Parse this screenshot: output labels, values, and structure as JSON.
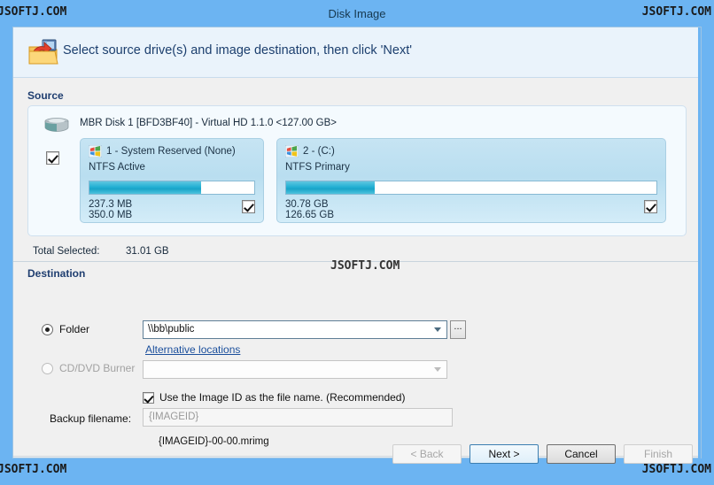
{
  "window": {
    "title": "Disk Image",
    "accent_color": "#6cb4f2"
  },
  "watermarks": {
    "top_left": "JSOFTJ.COM",
    "top_right": "JSOFTJ.COM",
    "bottom_left": "JSOFTJ.COM",
    "bottom_right": "JSOFTJ.COM",
    "center": "JSOFTJ.COM"
  },
  "header": {
    "instruction": "Select source drive(s) and image destination, then click 'Next'",
    "icon": "folder-restore-icon"
  },
  "source": {
    "heading": "Source",
    "disk": {
      "icon": "hard-disk-icon",
      "label": "MBR Disk 1 [BFD3BF40] - Virtual HD 1.1.0  <127.00 GB>",
      "selected": true
    },
    "partitions": [
      {
        "icon": "windows-flag-icon",
        "title": "1 - System Reserved (None)",
        "filesystem": "NTFS Active",
        "used_text": "237.3 MB",
        "total_text": "350.0 MB",
        "used_percent": 68,
        "selected": true
      },
      {
        "icon": "windows-flag-icon",
        "title": "2 -  (C:)",
        "filesystem": "NTFS Primary",
        "used_text": "30.78 GB",
        "total_text": "126.65 GB",
        "used_percent": 24,
        "selected": true
      }
    ],
    "total_selected_label": "Total Selected:",
    "total_selected_value": "31.01 GB"
  },
  "destination": {
    "heading": "Destination",
    "folder": {
      "radio_label": "Folder",
      "selected": true,
      "path_value": "\\\\bb\\public",
      "browse_label": "...",
      "alternative_locations_label": "Alternative locations"
    },
    "cd_burner": {
      "radio_label": "CD/DVD Burner",
      "selected": false,
      "enabled": false,
      "value": ""
    },
    "use_image_id": {
      "label": "Use the Image ID as the file name.  (Recommended)",
      "checked": true
    },
    "backup_filename": {
      "label": "Backup filename:",
      "value": "{IMAGEID}",
      "enabled": false
    },
    "filename_preview": "{IMAGEID}-00-00.mrimg"
  },
  "buttons": {
    "back": {
      "label": "< Back",
      "enabled": false
    },
    "next": {
      "label": "Next >",
      "enabled": true,
      "default": true
    },
    "cancel": {
      "label": "Cancel",
      "enabled": true
    },
    "finish": {
      "label": "Finish",
      "enabled": false
    }
  }
}
